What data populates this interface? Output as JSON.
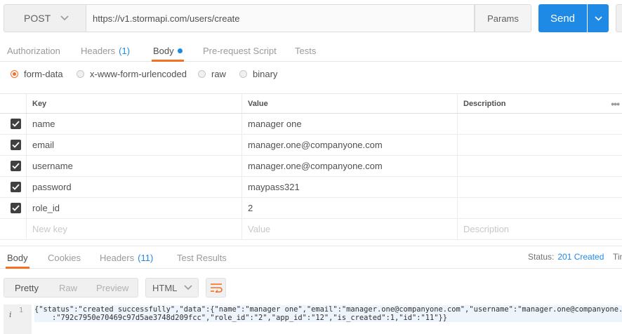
{
  "request": {
    "method": "POST",
    "url": "https://v1.stormapi.com/users/create",
    "params_label": "Params",
    "send_label": "Send"
  },
  "request_tabs": [
    {
      "label": "Authorization",
      "count": ""
    },
    {
      "label": "Headers",
      "count": "(1)"
    },
    {
      "label": "Body",
      "count": ""
    },
    {
      "label": "Pre-request Script",
      "count": ""
    },
    {
      "label": "Tests",
      "count": ""
    }
  ],
  "active_request_tab": "Body",
  "body_types": [
    "form-data",
    "x-www-form-urlencoded",
    "raw",
    "binary"
  ],
  "selected_body_type": "form-data",
  "form_table": {
    "headers": {
      "key": "Key",
      "value": "Value",
      "description": "Description"
    },
    "rows": [
      {
        "checked": true,
        "key": "name",
        "value": "manager one",
        "description": ""
      },
      {
        "checked": true,
        "key": "email",
        "value": "manager.one@companyone.com",
        "description": ""
      },
      {
        "checked": true,
        "key": "username",
        "value": "manager.one@companyone.com",
        "description": ""
      },
      {
        "checked": true,
        "key": "password",
        "value": "maypass321",
        "description": ""
      },
      {
        "checked": true,
        "key": "role_id",
        "value": "2",
        "description": ""
      }
    ],
    "new_row": {
      "key": "New key",
      "value": "Value",
      "description": "Description"
    }
  },
  "response_tabs": [
    {
      "label": "Body",
      "count": ""
    },
    {
      "label": "Cookies",
      "count": ""
    },
    {
      "label": "Headers",
      "count": "(11)"
    },
    {
      "label": "Test Results",
      "count": ""
    }
  ],
  "active_response_tab": "Body",
  "response_status": {
    "label": "Status:",
    "value": "201 Created",
    "time_label": "Tin"
  },
  "view_modes": [
    "Pretty",
    "Raw",
    "Preview"
  ],
  "active_view_mode": "Pretty",
  "format": "HTML",
  "code": {
    "line_number": "1",
    "info_icon": "i",
    "line1": "{\"status\":\"created successfully\",\"data\":{\"name\":\"manager one\",\"email\":\"manager.one@companyone.com\",\"username\":\"manager.one@companyone.com\",\"",
    "line2": "    :\"792c7950e70469c97d5ae3748d209fcc\",\"role_id\":\"2\",\"app_id\":\"12\",\"is_created\":1,\"id\":\"11\"}}"
  },
  "colors": {
    "accent": "#f47023",
    "link": "#1f8ae6",
    "send": "#1f8ae6"
  }
}
